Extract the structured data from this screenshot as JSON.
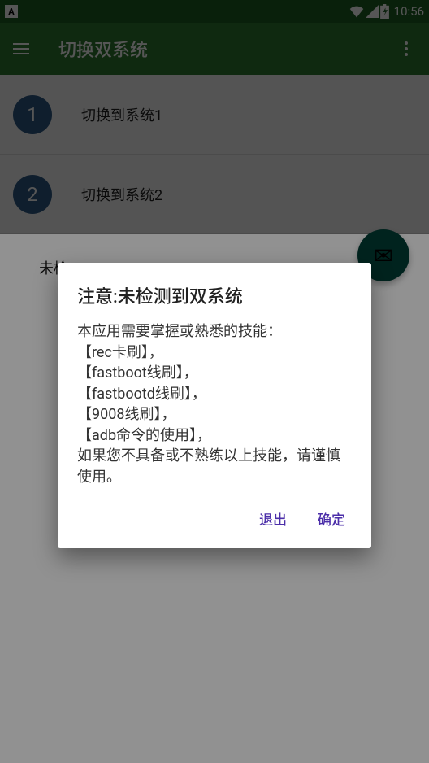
{
  "status_bar": {
    "a_badge": "A",
    "clock": "10:56"
  },
  "toolbar": {
    "title": "切换双系统"
  },
  "list": {
    "items": [
      {
        "num": "1",
        "label": "切换到系统1"
      },
      {
        "num": "2",
        "label": "切换到系统2"
      }
    ]
  },
  "status_line": "未检",
  "dialog": {
    "title": "注意:未检测到双系统",
    "body": "本应用需要掌握或熟悉的技能：\n【rec卡刷】，\n【fastboot线刷】，\n【fastbootd线刷】，\n【9008线刷】，\n【adb命令的使用】，\n如果您不具备或不熟练以上技能，请谨慎使用。",
    "exit": "退出",
    "confirm": "确定"
  }
}
